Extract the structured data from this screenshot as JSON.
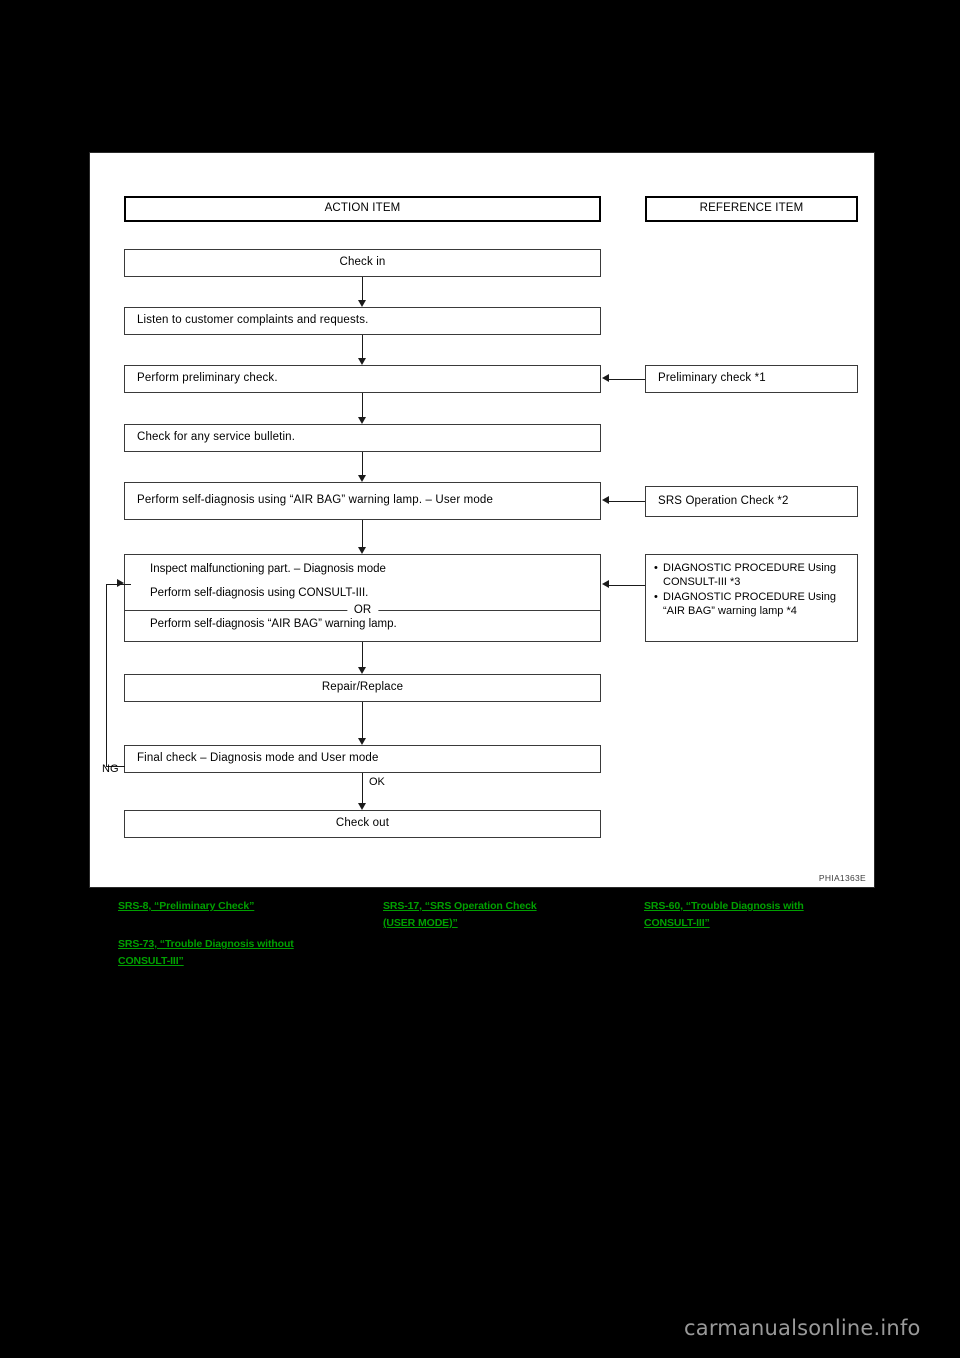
{
  "page": {
    "background_color": "#000000",
    "figure_code": "PHIA1363E",
    "watermark": "carmanualsonline.info"
  },
  "diagram": {
    "headers": {
      "action": "ACTION ITEM",
      "reference": "REFERENCE ITEM"
    },
    "action_steps": [
      {
        "id": "check-in",
        "label": "Check in",
        "align": "center"
      },
      {
        "id": "listen-complaints",
        "label": "Listen to customer complaints and requests.",
        "align": "left"
      },
      {
        "id": "preliminary-check",
        "label": "Perform preliminary check.",
        "align": "left"
      },
      {
        "id": "service-bulletin",
        "label": "Check for any service bulletin.",
        "align": "left"
      },
      {
        "id": "self-diagnosis-user-mode",
        "label": "Perform self-diagnosis using “AIR BAG” warning lamp. – User mode",
        "align": "left"
      },
      {
        "id": "repair-replace",
        "label": "Repair/Replace",
        "align": "center"
      },
      {
        "id": "final-check",
        "label": "Final check – Diagnosis mode and User mode",
        "align": "left"
      },
      {
        "id": "check-out",
        "label": "Check out",
        "align": "center"
      }
    ],
    "inspect_box": {
      "line1": "Inspect malfunctioning part. – Diagnosis mode",
      "line2": "Perform self-diagnosis using CONSULT-III.",
      "divider_label": "OR",
      "line3": "Perform self-diagnosis “AIR BAG” warning lamp."
    },
    "reference_items": [
      {
        "id": "preliminary-check-ref",
        "label": "Preliminary check *1"
      },
      {
        "id": "srs-operation-check-ref",
        "label": "SRS Operation Check *2"
      }
    ],
    "reference_bullets": [
      "DIAGNOSTIC PROCEDURE Using CONSULT-III *3",
      "DIAGNOSTIC PROCEDURE Using “AIR BAG” warning lamp *4"
    ],
    "edge_labels": {
      "ng": "NG",
      "ok": "OK"
    }
  },
  "links": {
    "column1": [
      "SRS-8, “Preliminary Check”",
      "SRS-73, “Trouble Diagnosis without\nCONSULT-III”"
    ],
    "column2": [
      "SRS-17, “SRS Operation Check\n(USER MODE)”"
    ],
    "column3": [
      "SRS-60, “Trouble Diagnosis with\nCONSULT-III”"
    ],
    "color": "#00a000"
  }
}
